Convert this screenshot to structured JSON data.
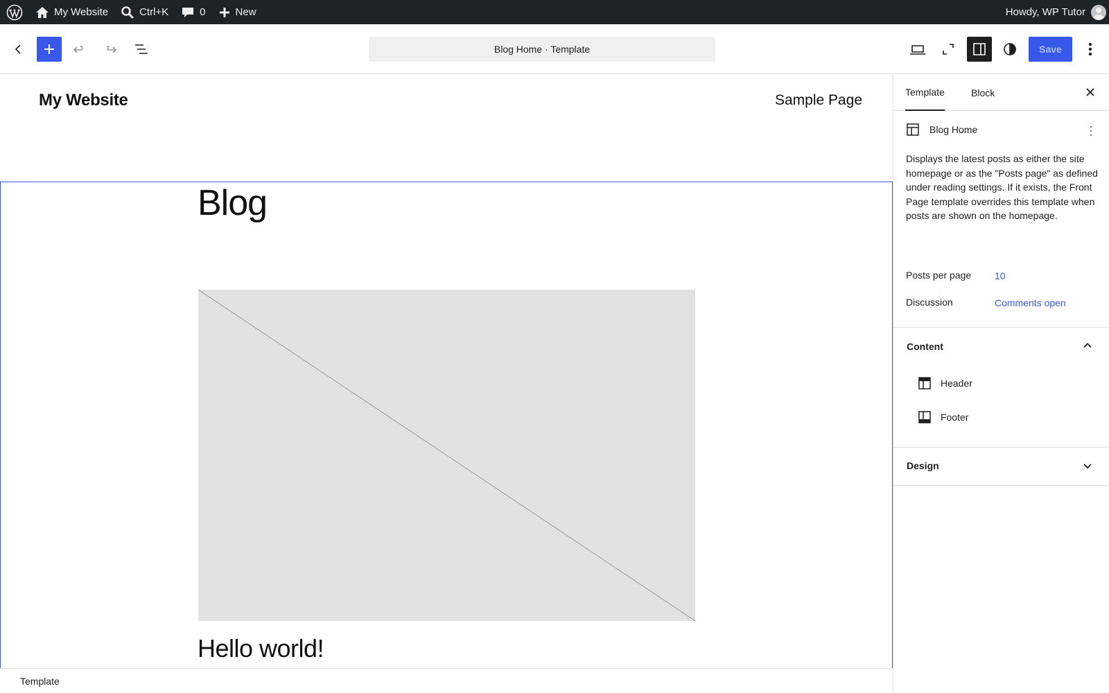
{
  "admin_bar": {
    "site_name": "My Website",
    "search_shortcut": "Ctrl+K",
    "comments_count": "0",
    "new_label": "New",
    "greeting": "Howdy, WP Tutor"
  },
  "editor_header": {
    "document_title": "Blog Home · Template",
    "save_label": "Save"
  },
  "canvas": {
    "site_title": "My Website",
    "nav_item": "Sample Page",
    "page_heading": "Blog",
    "post_title": "Hello world!"
  },
  "footer": {
    "breadcrumb": "Template"
  },
  "sidebar": {
    "tabs": [
      {
        "label": "Template",
        "active": true
      },
      {
        "label": "Block",
        "active": false
      }
    ],
    "template_name": "Blog Home",
    "description": "Displays the latest posts as either the site homepage or as the \"Posts page\" as defined under reading settings. If it exists, the Front Page template overrides this template when posts are shown on the homepage.",
    "properties": [
      {
        "label": "Posts per page",
        "value": "10"
      },
      {
        "label": "Discussion",
        "value": "Comments open"
      }
    ],
    "content_panel": {
      "title": "Content",
      "items": [
        {
          "label": "Header",
          "icon": "header-part-icon"
        },
        {
          "label": "Footer",
          "icon": "footer-part-icon"
        }
      ]
    },
    "design_panel": {
      "title": "Design"
    }
  },
  "colors": {
    "accent": "#3858e9",
    "admin_bar_bg": "#1d2327",
    "placeholder_bg": "#e2e2e2"
  }
}
